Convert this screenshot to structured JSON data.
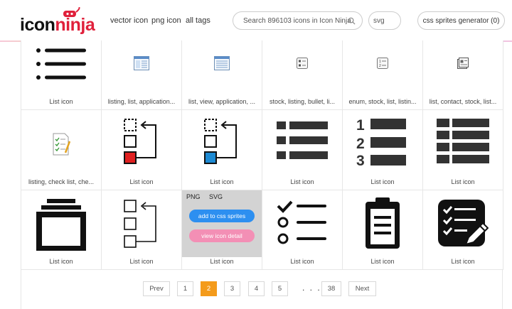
{
  "header": {
    "logo": {
      "part1": "icon",
      "part2": "ninja"
    },
    "nav": [
      {
        "label": "vector icon"
      },
      {
        "label": "png icon"
      },
      {
        "label": "all tags"
      }
    ],
    "search": {
      "placeholder": "Search 896103 icons in Icon Ninja"
    },
    "type_select": {
      "value": "svg"
    },
    "sprites_button": {
      "label": "css sprites generator (0)"
    }
  },
  "grid": {
    "cells": [
      {
        "icon": "list-bullet-icon",
        "label": "List icon"
      },
      {
        "icon": "listing-window-icon",
        "label": "listing, list, application..."
      },
      {
        "icon": "list-view-window-icon",
        "label": "list, view, application, ..."
      },
      {
        "icon": "stock-listing-icon",
        "label": "stock, listing, bullet, li..."
      },
      {
        "icon": "enum-stock-icon",
        "label": "enum, stock, list, listin..."
      },
      {
        "icon": "contact-stock-icon",
        "label": "list, contact, stock, list..."
      },
      {
        "icon": "checklist-clipboard-icon",
        "label": "listing, check list, che..."
      },
      {
        "icon": "list-move-red-icon",
        "label": "List icon"
      },
      {
        "icon": "list-move-blue-icon",
        "label": "List icon"
      },
      {
        "icon": "list-bars-icon",
        "label": "List icon"
      },
      {
        "icon": "numbered-list-icon",
        "label": "List icon"
      },
      {
        "icon": "list-columns-icon",
        "label": "List icon"
      },
      {
        "icon": "stack-icon",
        "label": "List icon"
      },
      {
        "icon": "list-move-outline-icon",
        "label": "List icon"
      },
      {
        "icon": "hovered-icon",
        "label": "List icon"
      },
      {
        "icon": "todo-list-icon",
        "label": "List icon"
      },
      {
        "icon": "clipboard-icon",
        "label": "List icon"
      },
      {
        "icon": "edit-list-icon",
        "label": "List icon"
      }
    ],
    "hover_overlay": {
      "tab_png": "PNG",
      "tab_svg": "SVG",
      "add_button": "add to css sprites",
      "view_button": "view icon detail",
      "add_color": "#2d8ff0",
      "view_color": "#f38fb5"
    }
  },
  "pagination": {
    "prev": "Prev",
    "pages": [
      "1",
      "2",
      "3",
      "4",
      "5"
    ],
    "active": "2",
    "ellipsis": ". . .",
    "last": "38",
    "next": "Next",
    "active_color": "#f49b1b"
  },
  "colors": {
    "brand_red": "#e0203b",
    "selected_red": "#e02020",
    "selected_blue": "#1d8ad3"
  }
}
